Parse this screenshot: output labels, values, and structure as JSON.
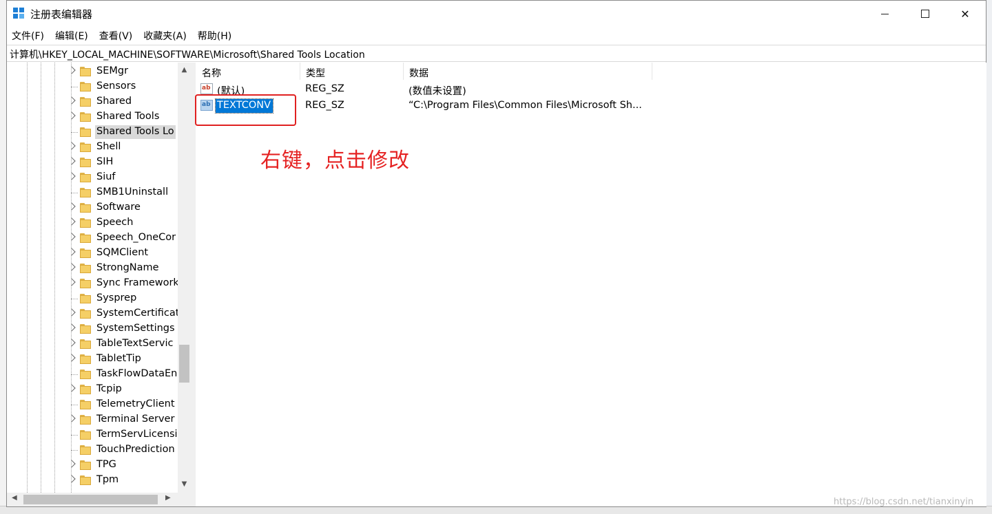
{
  "window": {
    "title": "注册表编辑器",
    "controls": {
      "minimize": "—",
      "maximize": "□",
      "close": "✕"
    }
  },
  "menu": [
    "文件(F)",
    "编辑(E)",
    "查看(V)",
    "收藏夹(A)",
    "帮助(H)"
  ],
  "address": "计算机\\HKEY_LOCAL_MACHINE\\SOFTWARE\\Microsoft\\Shared Tools Location",
  "tree": {
    "items": [
      {
        "label": "SEMgr",
        "expandable": true
      },
      {
        "label": "Sensors",
        "expandable": false
      },
      {
        "label": "Shared",
        "expandable": true
      },
      {
        "label": "Shared Tools",
        "expandable": true
      },
      {
        "label": "Shared Tools Lo",
        "expandable": false,
        "selected": true
      },
      {
        "label": "Shell",
        "expandable": true
      },
      {
        "label": "SIH",
        "expandable": true
      },
      {
        "label": "Siuf",
        "expandable": true
      },
      {
        "label": "SMB1Uninstall",
        "expandable": false
      },
      {
        "label": "Software",
        "expandable": true
      },
      {
        "label": "Speech",
        "expandable": true
      },
      {
        "label": "Speech_OneCor",
        "expandable": true
      },
      {
        "label": "SQMClient",
        "expandable": true
      },
      {
        "label": "StrongName",
        "expandable": true
      },
      {
        "label": "Sync Framework",
        "expandable": true
      },
      {
        "label": "Sysprep",
        "expandable": false
      },
      {
        "label": "SystemCertificat",
        "expandable": true
      },
      {
        "label": "SystemSettings",
        "expandable": true
      },
      {
        "label": "TableTextServic",
        "expandable": true
      },
      {
        "label": "TabletTip",
        "expandable": true
      },
      {
        "label": "TaskFlowDataEn",
        "expandable": false
      },
      {
        "label": "Tcpip",
        "expandable": true
      },
      {
        "label": "TelemetryClient",
        "expandable": false
      },
      {
        "label": "Terminal Server",
        "expandable": true
      },
      {
        "label": "TermServLicensi",
        "expandable": false
      },
      {
        "label": "TouchPrediction",
        "expandable": false
      },
      {
        "label": "TPG",
        "expandable": true
      },
      {
        "label": "Tpm",
        "expandable": true
      }
    ]
  },
  "list": {
    "columns": {
      "name": "名称",
      "type": "类型",
      "data": "数据"
    },
    "rows": [
      {
        "icon": "ab",
        "name": "(默认)",
        "type": "REG_SZ",
        "data": "(数值未设置)",
        "selected": false
      },
      {
        "icon": "ab",
        "name": "TEXTCONV",
        "type": "REG_SZ",
        "data": "“C:\\Program Files\\Common Files\\Microsoft Sh...",
        "selected": true
      }
    ]
  },
  "annotation": "右键，点击修改",
  "annotation_color": "#e52222",
  "watermark": "https://blog.csdn.net/tianxinyin",
  "colors": {
    "selection": "#0078d7",
    "folder": "#f5cf66"
  }
}
